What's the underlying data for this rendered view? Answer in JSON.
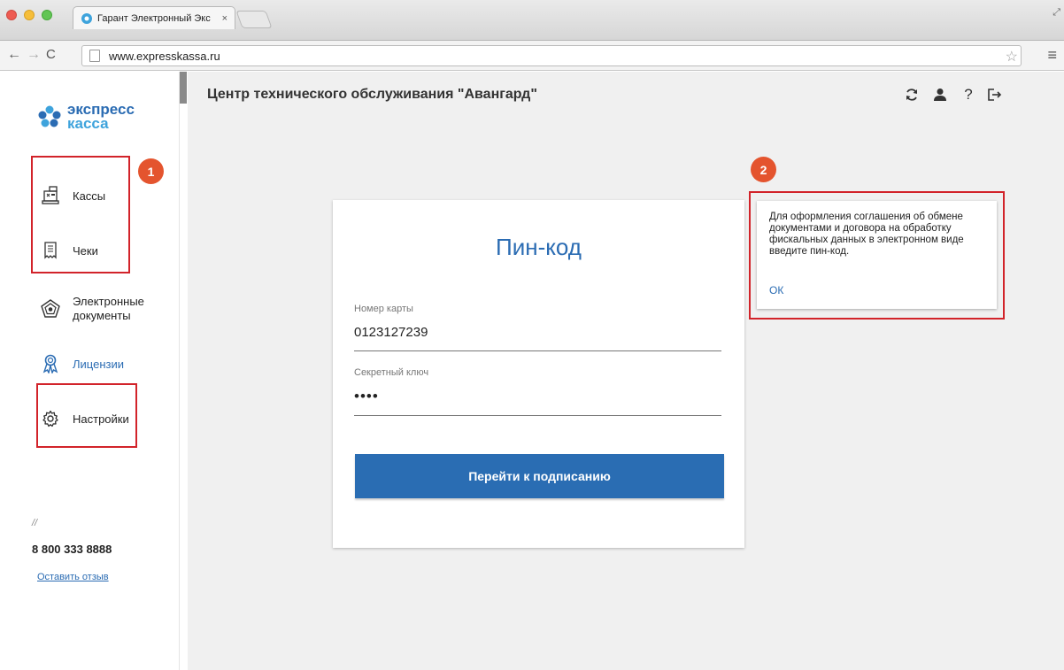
{
  "browser": {
    "tab_title": "Гарант Электронный Экс",
    "tab_close": "×",
    "url": "www.expresskassa.ru"
  },
  "sidebar": {
    "logo_line1": "экспресс",
    "logo_line2": "касса",
    "items": [
      {
        "label": "Кассы",
        "icon": "cash-register-icon"
      },
      {
        "label": "Чеки",
        "icon": "receipt-icon"
      },
      {
        "label_line1": "Электронные",
        "label_line2": "документы",
        "icon": "pentagon-document-icon"
      },
      {
        "label": "Лицензии",
        "icon": "award-ribbon-icon"
      },
      {
        "label": "Настройки",
        "icon": "gear-icon"
      }
    ],
    "separator": "//",
    "phone": "8 800 333 8888",
    "feedback_link": "Оставить отзыв"
  },
  "annotations": {
    "badge_1": "1",
    "badge_2": "2",
    "highlight_color": "#d2232a",
    "badge_color": "#e4542e"
  },
  "main": {
    "title": "Центр технического обслуживания \"Авангард\"",
    "header_icons": [
      "refresh-icon",
      "user-icon",
      "help-icon",
      "exit-icon"
    ],
    "help_glyph": "?"
  },
  "pin_form": {
    "title": "Пин-код",
    "card_number_label": "Номер карты",
    "card_number_value": "0123127239",
    "secret_key_label": "Секретный ключ",
    "secret_key_value": "••••",
    "submit_label": "Перейти к подписанию"
  },
  "tooltip": {
    "text": "Для оформления соглашения об обмене документами и договора на обработку фискальных данных в электронном виде введите пин-код.",
    "ok_label": "ОК"
  },
  "colors": {
    "accent": "#2b6cb3",
    "accent_light": "#3ea3dc",
    "button": "#2a6db3",
    "background": "#f0f0f0"
  }
}
